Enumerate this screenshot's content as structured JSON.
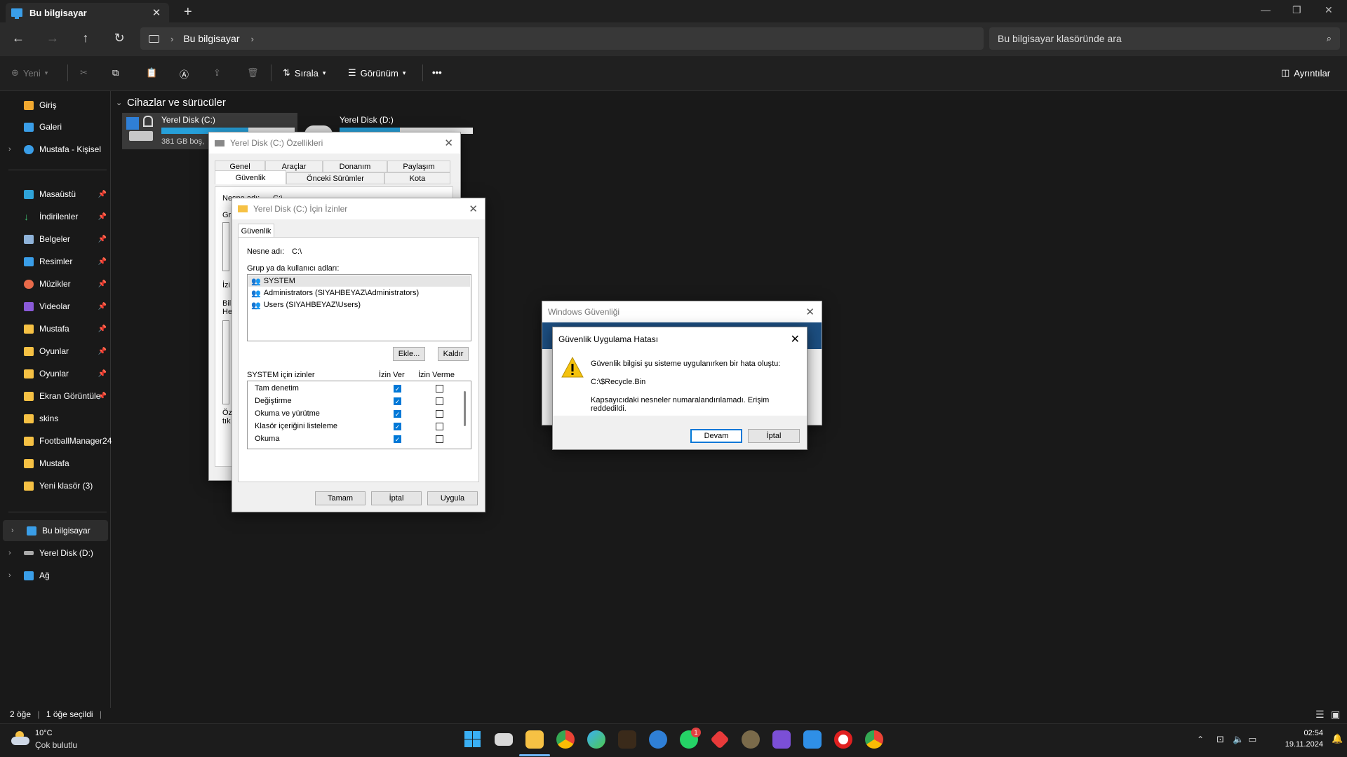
{
  "window": {
    "tab_title": "Bu bilgisayar",
    "new_tab": "+"
  },
  "address": {
    "location": "Bu bilgisayar",
    "search_placeholder": "Bu bilgisayar klasöründe ara"
  },
  "toolbar": {
    "new": "Yeni",
    "sort": "Sırala",
    "view": "Görünüm",
    "more": "•••",
    "details": "Ayrıntılar"
  },
  "sidebar": {
    "quick": [
      {
        "label": "Giriş"
      },
      {
        "label": "Galeri"
      },
      {
        "label": "Mustafa - Kişisel"
      }
    ],
    "pinned": [
      {
        "label": "Masaüstü"
      },
      {
        "label": "İndirilenler"
      },
      {
        "label": "Belgeler"
      },
      {
        "label": "Resimler"
      },
      {
        "label": "Müzikler"
      },
      {
        "label": "Videolar"
      },
      {
        "label": "Mustafa"
      },
      {
        "label": "Oyunlar"
      },
      {
        "label": "Oyunlar"
      },
      {
        "label": "Ekran Görüntüle"
      },
      {
        "label": "skins"
      },
      {
        "label": "FootballManager24"
      },
      {
        "label": "Mustafa"
      },
      {
        "label": "Yeni klasör (3)"
      }
    ],
    "locations": [
      {
        "label": "Bu bilgisayar"
      },
      {
        "label": "Yerel Disk (D:)"
      },
      {
        "label": "Ağ"
      }
    ]
  },
  "content": {
    "group_title": "Cihazlar ve sürücüler",
    "drives": [
      {
        "name": "Yerel Disk (C:)",
        "free": "381 GB boş,",
        "used_fraction": 0.65
      },
      {
        "name": "Yerel Disk (D:)",
        "free": "",
        "used_fraction": 0.45
      }
    ]
  },
  "status": {
    "items": "2 öğe",
    "selected": "1 öğe seçildi"
  },
  "props_dialog": {
    "title": "Yerel Disk (C:) Özellikleri",
    "tabs_row1": [
      "Genel",
      "Araçlar",
      "Donanım",
      "Paylaşım"
    ],
    "tabs_row2": [
      "Güvenlik",
      "Önceki Sürümler",
      "Kota"
    ],
    "peek": [
      "Nesne adı:",
      "C:\\",
      "Gr",
      "İzi",
      "Bili",
      "He",
      "Öz",
      "tık"
    ]
  },
  "perm_dialog": {
    "title": "Yerel Disk (C:) İçin İzinler",
    "tab": "Güvenlik",
    "object_label": "Nesne adı:",
    "object_value": "C:\\",
    "group_label": "Grup ya da kullanıcı adları:",
    "users": [
      "SYSTEM",
      "Administrators (SIYAHBEYAZ\\Administrators)",
      "Users (SIYAHBEYAZ\\Users)"
    ],
    "add": "Ekle...",
    "remove": "Kaldır",
    "perm_label": "SYSTEM için izinler",
    "allow": "İzin Ver",
    "deny": "İzin Verme",
    "perms": [
      "Tam denetim",
      "Değiştirme",
      "Okuma ve yürütme",
      "Klasör içeriğini listeleme",
      "Okuma"
    ],
    "ok": "Tamam",
    "cancel": "İptal",
    "apply": "Uygula"
  },
  "security_dialog": {
    "title": "Windows Güvenliği"
  },
  "error_dialog": {
    "title": "Güvenlik Uygulama Hatası",
    "line1": "Güvenlik bilgisi şu sisteme uygulanırken bir hata oluştu:",
    "path": "C:\\$Recycle.Bin",
    "line2": "Kapsayıcıdaki nesneler numaralandırılamadı. Erişim reddedildi.",
    "continue": "Devam",
    "cancel": "İptal"
  },
  "taskbar": {
    "weather_temp": "10°C",
    "weather_desc": "Çok bulutlu",
    "time": "02:54",
    "date": "19.11.2024",
    "whatsapp_badge": "1"
  },
  "colors": {
    "accent": "#0078d7",
    "folder": "#f6c144",
    "drive_bar": "#26a0da"
  }
}
